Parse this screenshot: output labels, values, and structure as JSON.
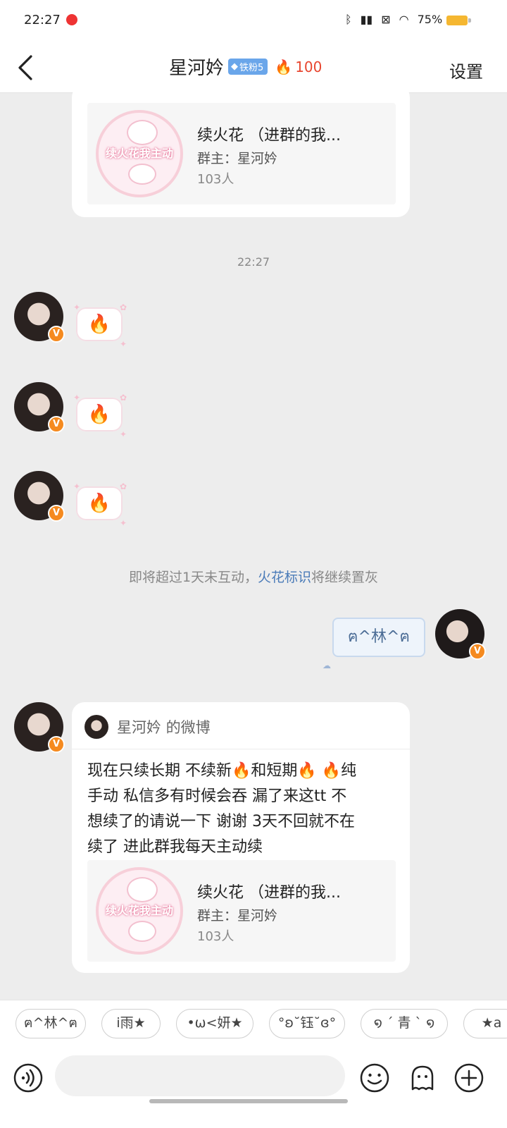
{
  "status": {
    "time": "22:27",
    "battery": "75%"
  },
  "header": {
    "title": "星河妗",
    "fan_badge": "铁粉5",
    "flame_count": "100",
    "settings": "设置"
  },
  "top_card": {
    "group_name": "续火花 （进群的我...",
    "group_owner": "群主：星河妗",
    "group_count": "103人",
    "logo_text": "续火花我主动"
  },
  "timestamp": "22:27",
  "messages": {
    "flame1": "🔥",
    "flame2": "🔥",
    "flame3": "🔥"
  },
  "notice": {
    "before": "即将超过1天未互动，",
    "link": "火花标识",
    "after": "将继续置灰"
  },
  "my_message": "ฅ^林^ฅ",
  "share": {
    "source": "星河妗 的微博",
    "lines": [
      "现在只续长期 不续新🔥和短期🔥 🔥纯",
      "手动 私信多有时候会吞 漏了来这tt 不",
      "想续了的请说一下 谢谢 3天不回就不在",
      "续了 进此群我每天主动续"
    ],
    "group_name": "续火花 （进群的我...",
    "group_owner": "群主：星河妗",
    "group_count": "103人",
    "logo_text": "续火花我主动"
  },
  "chips": [
    "ฅ^林^ฅ",
    "i雨★",
    "•ω<妍★",
    "°ʚ˘钰˘ɞ°",
    "໑ ´ 青 ` ໑",
    "★a"
  ],
  "icons": {
    "back": "chevron-left-icon",
    "voice": "voice-icon",
    "emoji": "emoji-icon",
    "sticker": "sticker-icon",
    "plus": "plus-icon"
  },
  "colors": {
    "accent_flame": "#e8462f",
    "link": "#4a7bb8",
    "fan_badge": "#6aa6ea",
    "verified": "#f58a1f"
  }
}
